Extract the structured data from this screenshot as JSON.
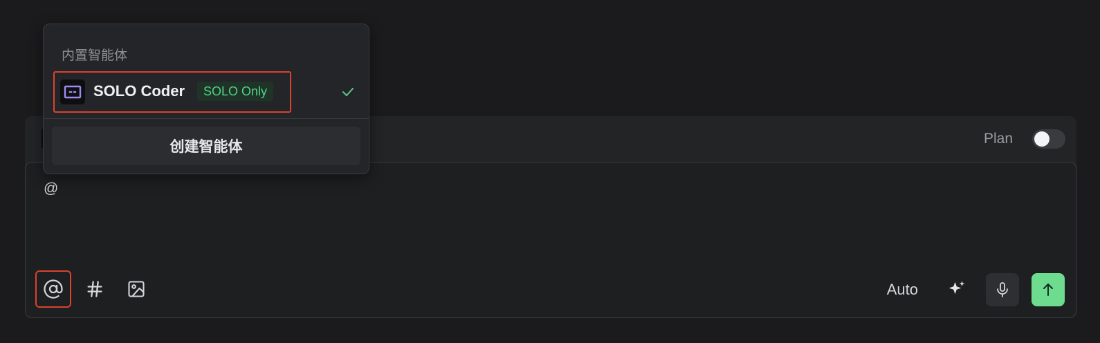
{
  "composer": {
    "plan_label": "Plan",
    "plan_enabled": false,
    "input_value": "@",
    "model_label": "Auto",
    "tools": {
      "mention_icon": "at-sign-icon",
      "topic_icon": "hash-icon",
      "image_icon": "image-icon"
    }
  },
  "dropdown": {
    "section_title": "内置智能体",
    "agents": [
      {
        "name": "SOLO Coder",
        "badge": "SOLO Only",
        "selected": true
      }
    ],
    "create_label": "创建智能体"
  },
  "colors": {
    "accent_green": "#6ddc8f",
    "badge_green": "#4fd483",
    "highlight_red": "#d9432f",
    "avatar_purple": "#9b8cf0"
  }
}
